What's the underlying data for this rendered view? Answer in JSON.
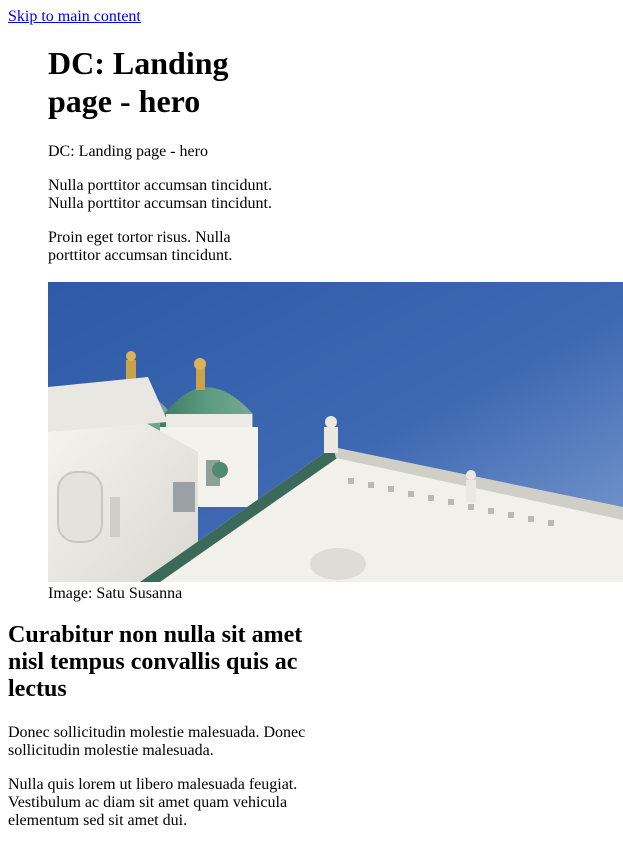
{
  "skip_link": "Skip to main content",
  "hero": {
    "title": "DC: Landing page - hero",
    "subtitle": "DC: Landing page - hero",
    "paragraph_1": "Nulla porttitor accumsan tincidunt. Nulla porttitor accumsan tincidunt.",
    "paragraph_2": "Proin eget tortor risus. Nulla porttitor accumsan tincidunt.",
    "image_caption": "Image: Satu Susanna"
  },
  "content": {
    "heading": "Curabitur non nulla sit amet nisl tempus convallis quis ac lectus",
    "paragraph_1": "Donec sollicitudin molestie malesuada. Donec sollicitudin molestie malesuada.",
    "paragraph_2": "Nulla quis lorem ut libero malesuada feugiat. Vestibulum ac diam sit amet quam vehicula elementum sed sit amet dui."
  },
  "colors": {
    "link": "#0000ee",
    "sky": "#3f69b0",
    "building": "#f2f1ec",
    "dome": "#4f8a72"
  }
}
